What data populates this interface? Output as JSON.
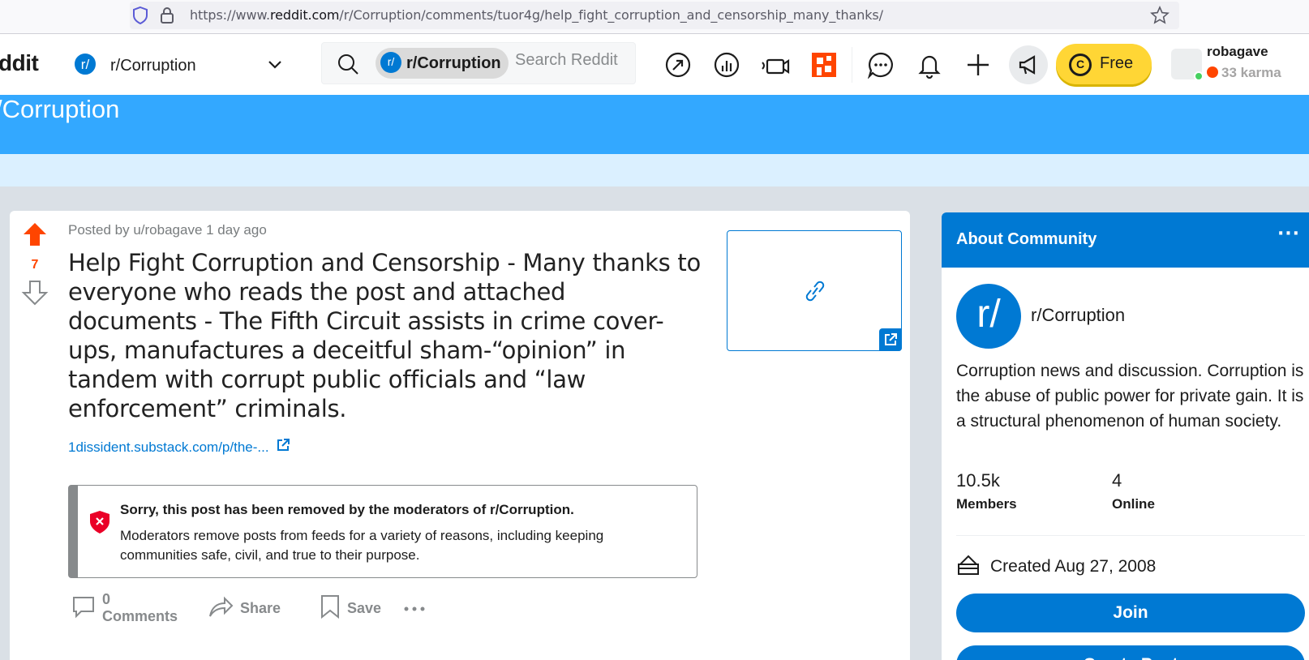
{
  "browser": {
    "url_prefix": "https://www.",
    "url_domain": "reddit.com",
    "url_path": "/r/Corruption/comments/tuor4g/help_fight_corruption_and_censorship_many_thanks/"
  },
  "header": {
    "logo_text": "ddit",
    "subreddit": "r/Corruption",
    "r_glyph": "r/",
    "search_chip": "r/Corruption",
    "search_placeholder": "Search Reddit",
    "icons": [
      "popular-icon",
      "stats-icon",
      "live-icon",
      "coins-icon",
      "chat-icon",
      "notifications-icon",
      "create-post-icon",
      "advertise-icon"
    ],
    "free_label": "Free",
    "coin_glyph": "C",
    "username": "robagave",
    "karma": "33 karma"
  },
  "banner": {
    "title": "/Corruption"
  },
  "post": {
    "score": "7",
    "posted_by": "Posted by u/robagave 1 day ago",
    "title": "Help Fight Corruption and Censorship - Many thanks to everyone who reads the post and attached documents - The Fifth Circuit assists in crime cover-ups, manufactures a deceitful sham-“opinion” in tandem with corrupt public officials and “law enforcement” criminals.",
    "link_text": "1dissident.substack.com/p/the-...",
    "removed": {
      "title": "Sorry, this post has been removed by the moderators of r/Corruption.",
      "body": "Moderators remove posts from feeds for a variety of reasons, including keeping communities safe, civil, and true to their purpose."
    },
    "actions": {
      "comments_count": "0",
      "comments_label": "Comments",
      "share_label": "Share",
      "save_label": "Save"
    }
  },
  "sidebar": {
    "title": "About Community",
    "more": "···",
    "avatar_glyph": "r/",
    "name": "r/Corruption",
    "description": "Corruption news and discussion. Corruption is the abuse of public power for private gain. It is a structural phenomenon of human society.",
    "members_value": "10.5k",
    "members_label": "Members",
    "online_value": "4",
    "online_label": "Online",
    "created": "Created Aug 27, 2008",
    "join_label": "Join",
    "create_post_label": "Create Post"
  },
  "colors": {
    "accent": "#0079d3",
    "upvote": "#ff4500",
    "banner": "#33a8ff",
    "banner_sub": "#dbf0ff",
    "coin_button": "#ffd635"
  }
}
